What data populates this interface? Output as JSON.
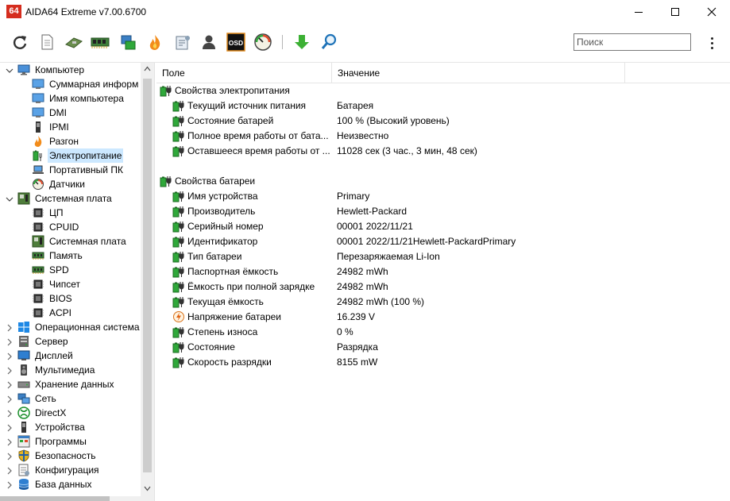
{
  "window": {
    "logo_text": "64",
    "title": "AIDA64 Extreme v7.00.6700"
  },
  "toolbar": {
    "icons": [
      "refresh-icon",
      "report-icon",
      "motherboard-icon",
      "memory-icon",
      "network-icon",
      "flame-icon",
      "benchmark-icon",
      "user-icon",
      "osd-icon",
      "gauge-icon",
      "download-icon",
      "search-icon"
    ],
    "osd_label": "OSD",
    "search_placeholder": "Поиск"
  },
  "tree": [
    {
      "label": "Компьютер",
      "level": 0,
      "expanded": true,
      "icon": "computer-icon"
    },
    {
      "label": "Суммарная информ",
      "level": 1,
      "icon": "monitor-icon"
    },
    {
      "label": "Имя компьютера",
      "level": 1,
      "icon": "monitor-icon"
    },
    {
      "label": "DMI",
      "level": 1,
      "icon": "monitor-icon"
    },
    {
      "label": "IPMI",
      "level": 1,
      "icon": "device-icon"
    },
    {
      "label": "Разгон",
      "level": 1,
      "icon": "flame-icon"
    },
    {
      "label": "Электропитание",
      "level": 1,
      "icon": "battery-icon",
      "selected": true
    },
    {
      "label": "Портативный ПК",
      "level": 1,
      "icon": "laptop-icon"
    },
    {
      "label": "Датчики",
      "level": 1,
      "icon": "gauge-icon"
    },
    {
      "label": "Системная плата",
      "level": 0,
      "expanded": true,
      "icon": "motherboard-icon"
    },
    {
      "label": "ЦП",
      "level": 1,
      "icon": "chip-icon"
    },
    {
      "label": "CPUID",
      "level": 1,
      "icon": "chip-icon"
    },
    {
      "label": "Системная плата",
      "level": 1,
      "icon": "motherboard-icon"
    },
    {
      "label": "Память",
      "level": 1,
      "icon": "memory-icon"
    },
    {
      "label": "SPD",
      "level": 1,
      "icon": "memory-icon"
    },
    {
      "label": "Чипсет",
      "level": 1,
      "icon": "chip-icon"
    },
    {
      "label": "BIOS",
      "level": 1,
      "icon": "chip-icon"
    },
    {
      "label": "ACPI",
      "level": 1,
      "icon": "chip-icon"
    },
    {
      "label": "Операционная система",
      "level": 0,
      "expanded": false,
      "icon": "windows-icon"
    },
    {
      "label": "Сервер",
      "level": 0,
      "expanded": false,
      "icon": "server-icon"
    },
    {
      "label": "Дисплей",
      "level": 0,
      "expanded": false,
      "icon": "display-icon"
    },
    {
      "label": "Мультимедиа",
      "level": 0,
      "expanded": false,
      "icon": "speaker-icon"
    },
    {
      "label": "Хранение данных",
      "level": 0,
      "expanded": false,
      "icon": "storage-icon"
    },
    {
      "label": "Сеть",
      "level": 0,
      "expanded": false,
      "icon": "network-icon"
    },
    {
      "label": "DirectX",
      "level": 0,
      "expanded": false,
      "icon": "xbox-icon"
    },
    {
      "label": "Устройства",
      "level": 0,
      "expanded": false,
      "icon": "device-icon"
    },
    {
      "label": "Программы",
      "level": 0,
      "expanded": false,
      "icon": "programs-icon"
    },
    {
      "label": "Безопасность",
      "level": 0,
      "expanded": false,
      "icon": "shield-icon"
    },
    {
      "label": "Конфигурация",
      "level": 0,
      "expanded": false,
      "icon": "config-icon"
    },
    {
      "label": "База данных",
      "level": 0,
      "expanded": false,
      "icon": "database-icon"
    }
  ],
  "grid": {
    "columns": [
      "Поле",
      "Значение"
    ],
    "rows": [
      {
        "type": "group",
        "field": "Свойства электропитания",
        "value": "",
        "icon": "battery-plug-icon"
      },
      {
        "type": "item",
        "field": "Текущий источник питания",
        "value": "Батарея",
        "icon": "battery-plug-icon"
      },
      {
        "type": "item",
        "field": "Состояние батарей",
        "value": "100 % (Высокий уровень)",
        "icon": "battery-plug-icon"
      },
      {
        "type": "item",
        "field": "Полное время работы от бата...",
        "value": "Неизвестно",
        "icon": "battery-plug-icon"
      },
      {
        "type": "item",
        "field": "Оставшееся время работы от ...",
        "value": "11028 сек (3 час., 3 мин, 48 сек)",
        "icon": "battery-plug-icon"
      },
      {
        "type": "blank"
      },
      {
        "type": "group",
        "field": "Свойства батареи",
        "value": "",
        "icon": "battery-plug-icon"
      },
      {
        "type": "item",
        "field": "Имя устройства",
        "value": "Primary",
        "icon": "battery-plug-icon"
      },
      {
        "type": "item",
        "field": "Производитель",
        "value": "Hewlett-Packard",
        "icon": "battery-plug-icon"
      },
      {
        "type": "item",
        "field": "Серийный номер",
        "value": "00001 2022/11/21",
        "icon": "battery-plug-icon"
      },
      {
        "type": "item",
        "field": "Идентификатор",
        "value": "00001 2022/11/21Hewlett-PackardPrimary",
        "icon": "battery-plug-icon"
      },
      {
        "type": "item",
        "field": "Тип батареи",
        "value": "Перезаряжаемая Li-Ion",
        "icon": "battery-plug-icon"
      },
      {
        "type": "item",
        "field": "Паспортная ёмкость",
        "value": "24982 mWh",
        "icon": "battery-plug-icon"
      },
      {
        "type": "item",
        "field": "Ёмкость при полной зарядке",
        "value": "24982 mWh",
        "icon": "battery-plug-icon"
      },
      {
        "type": "item",
        "field": "Текущая ёмкость",
        "value": "24982 mWh  (100 %)",
        "icon": "battery-plug-icon"
      },
      {
        "type": "item",
        "field": "Напряжение батареи",
        "value": "16.239 V",
        "icon": "voltage-icon"
      },
      {
        "type": "item",
        "field": "Степень износа",
        "value": "0 %",
        "icon": "battery-plug-icon"
      },
      {
        "type": "item",
        "field": "Состояние",
        "value": "Разрядка",
        "icon": "battery-plug-icon"
      },
      {
        "type": "item",
        "field": "Скорость разрядки",
        "value": "8155 mW",
        "icon": "battery-plug-icon"
      }
    ]
  },
  "colors": {
    "accent": "#0078d7",
    "selection": "#cce8ff",
    "battery_green": "#2fa83a",
    "logo_red": "#d52d1e"
  }
}
